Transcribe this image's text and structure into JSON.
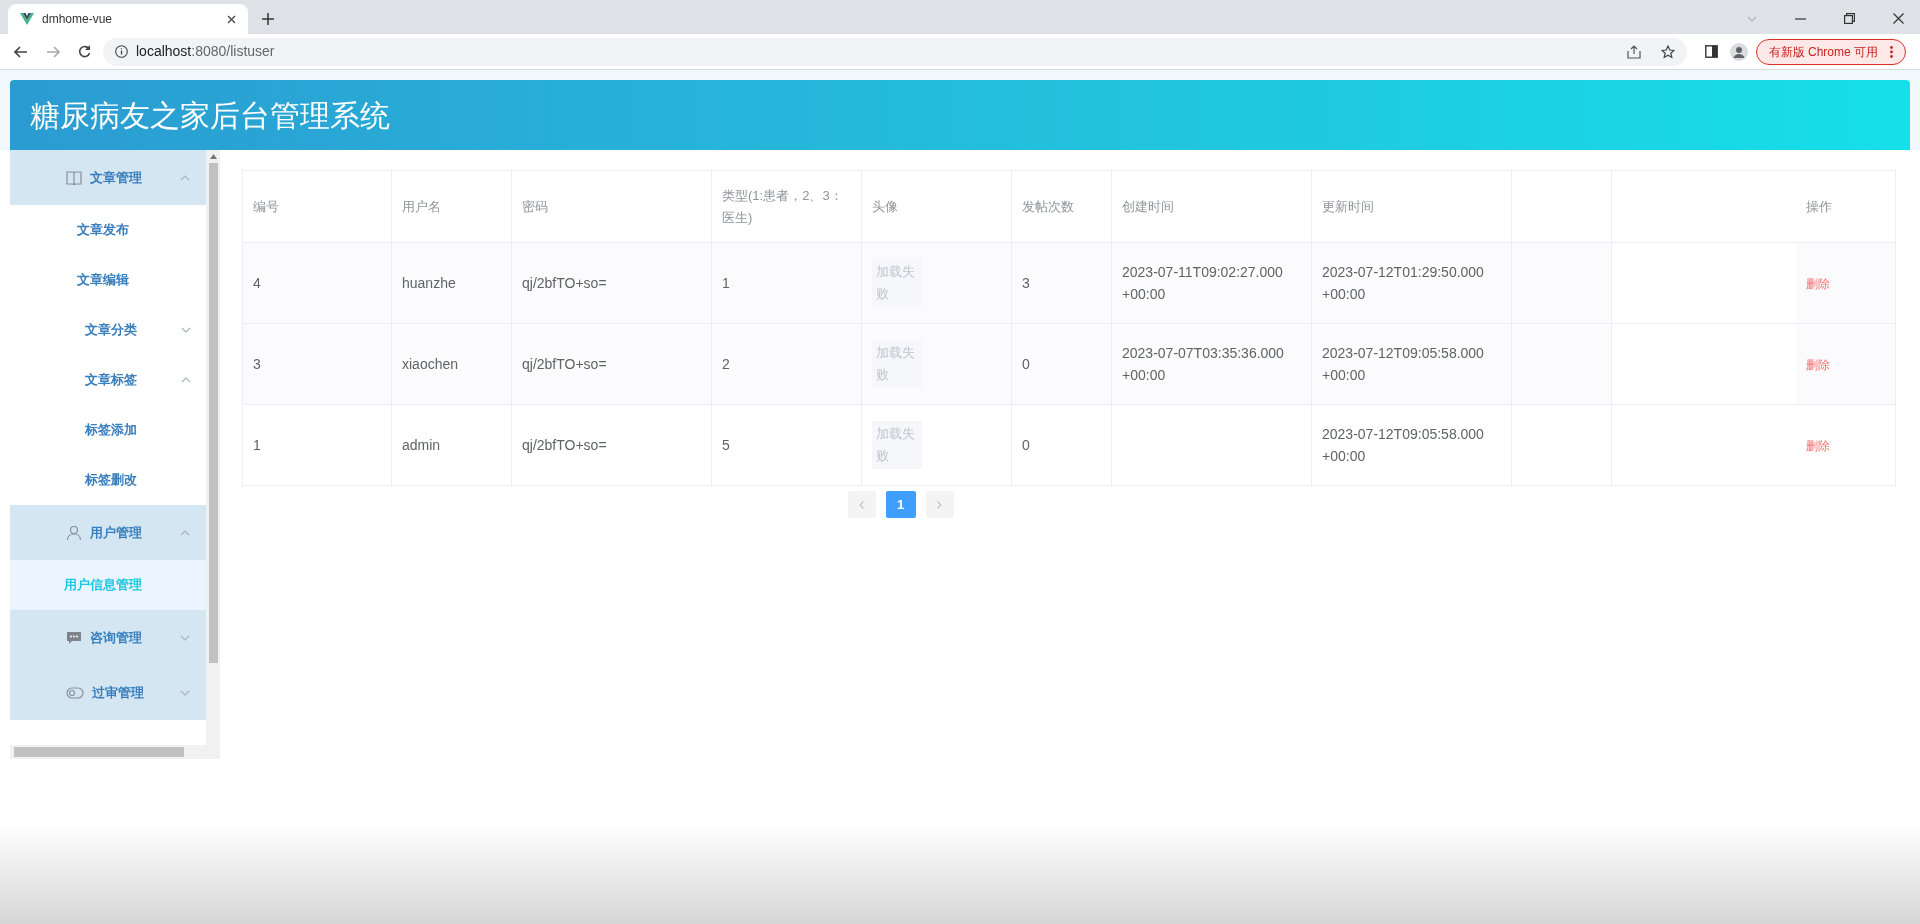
{
  "browser": {
    "tab_title": "dmhome-vue",
    "url_host": "localhost",
    "url_rest": ":8080/listuser",
    "update_button": "有新版 Chrome 可用"
  },
  "header": {
    "title": "糖尿病友之家后台管理系统"
  },
  "sidebar": {
    "items": [
      {
        "label": "文章管理",
        "kind": "book",
        "expanded": true,
        "selected": false,
        "children": [
          {
            "label": "文章发布",
            "selected": false
          },
          {
            "label": "文章编辑",
            "selected": false
          },
          {
            "label": "文章分类",
            "expanded": false,
            "selected": false
          },
          {
            "label": "文章标签",
            "expanded": true,
            "selected": false,
            "children": [
              {
                "label": "标签添加",
                "selected": false
              },
              {
                "label": "标签删改",
                "selected": false
              }
            ]
          }
        ]
      },
      {
        "label": "用户管理",
        "kind": "user",
        "expanded": true,
        "selected": false,
        "children": [
          {
            "label": "用户信息管理",
            "selected": true
          }
        ]
      },
      {
        "label": "咨询管理",
        "kind": "message",
        "expanded": false,
        "selected": false
      },
      {
        "label": "过审管理",
        "kind": "toggle",
        "expanded": false,
        "selected": false
      }
    ]
  },
  "table": {
    "columns": [
      "编号",
      "用户名",
      "密码",
      "类型(1:患者，2、3：医生)",
      "头像",
      "发帖次数",
      "创建时间",
      "更新时间",
      "操作"
    ],
    "rows": [
      {
        "id": "4",
        "username": "huanzhe",
        "password": "qj/2bfTO+so=",
        "type": "1",
        "avatar": "加载失败",
        "posts": "3",
        "created": "2023-07-11T09:02:27.000 +00:00",
        "updated": "2023-07-12T01:29:50.000 +00:00",
        "action": "删除"
      },
      {
        "id": "3",
        "username": "xiaochen",
        "password": "qj/2bfTO+so=",
        "type": "2",
        "avatar": "加载失败",
        "posts": "0",
        "created": "2023-07-07T03:35:36.000 +00:00",
        "updated": "2023-07-12T09:05:58.000 +00:00",
        "action": "删除"
      },
      {
        "id": "1",
        "username": "admin",
        "password": "qj/2bfTO+so=",
        "type": "5",
        "avatar": "加载失败",
        "posts": "0",
        "updated": "2023-07-12T09:05:58.000 +00:00",
        "action": "删除"
      }
    ]
  },
  "pagination": {
    "pages": [
      {
        "label": "1",
        "selected": true
      }
    ]
  }
}
